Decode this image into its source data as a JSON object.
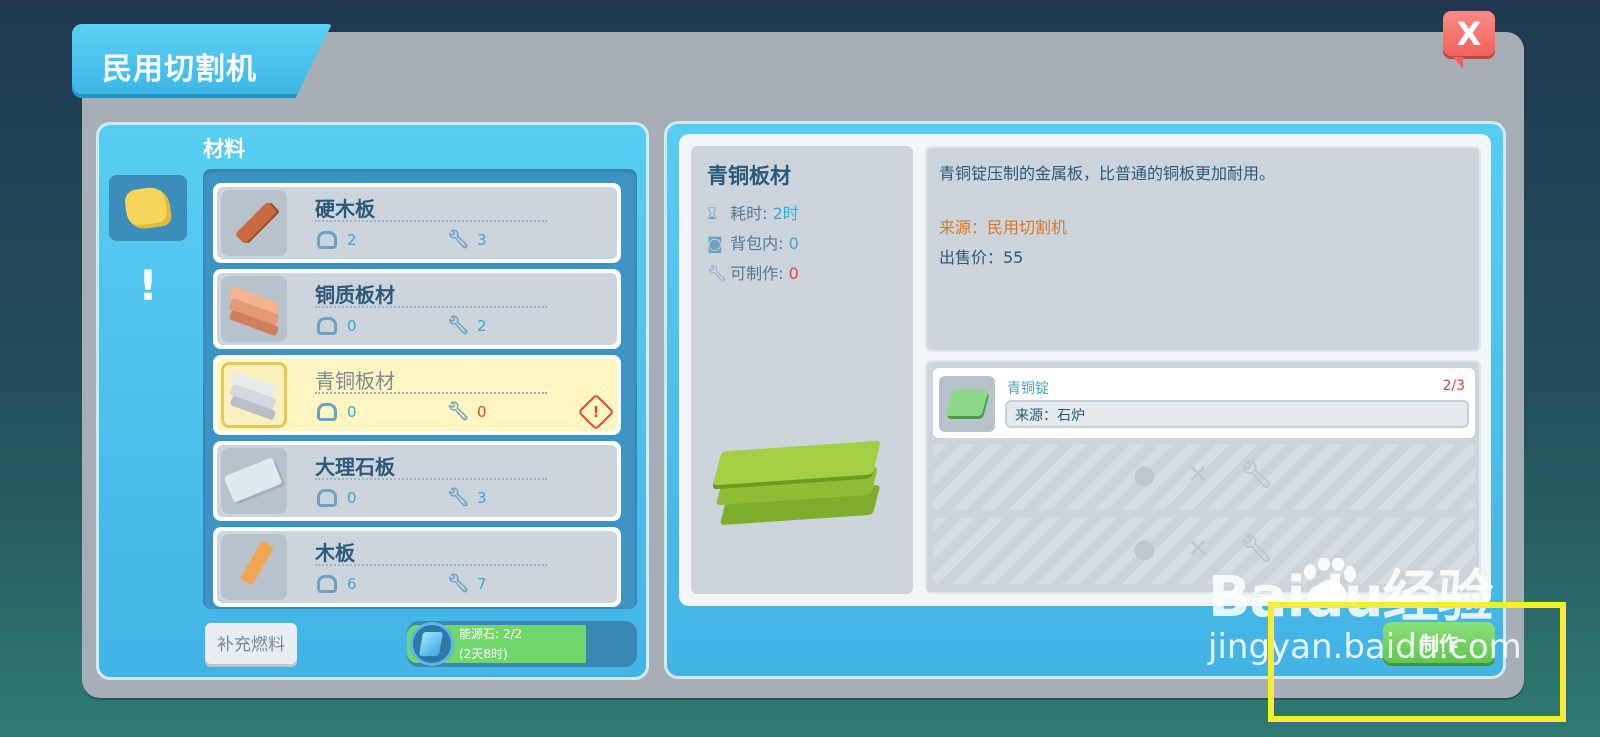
{
  "window": {
    "title": "民用切割机",
    "close_label": "X"
  },
  "left_panel": {
    "section_label": "材料",
    "category_tabs": [
      {
        "icon": "material-icon",
        "selected": true
      },
      {
        "icon": "exclamation-icon",
        "label": "!",
        "selected": false
      }
    ],
    "items": [
      {
        "name": "硬木板",
        "in_bag": "2",
        "craftable": "3",
        "thumb": "hardwood-plank",
        "selected": false
      },
      {
        "name": "铜质板材",
        "in_bag": "0",
        "craftable": "2",
        "thumb": "copper-plank",
        "selected": false
      },
      {
        "name": "青铜板材",
        "in_bag": "0",
        "craftable": "0",
        "thumb": "bronze-plank",
        "selected": true,
        "warning": "!"
      },
      {
        "name": "大理石板",
        "in_bag": "0",
        "craftable": "3",
        "thumb": "marble-slab",
        "selected": false
      },
      {
        "name": "木板",
        "in_bag": "6",
        "craftable": "7",
        "thumb": "wood-plank",
        "selected": false
      }
    ],
    "refuel_label": "补充燃料",
    "energy": {
      "label": "能源石: 2/2",
      "time": "(2天8时)",
      "fill_fraction": 0.78
    }
  },
  "detail": {
    "name": "青铜板材",
    "time_label": "耗时:",
    "time_value": "2时",
    "bag_label": "背包内:",
    "bag_value": "0",
    "craftable_label": "可制作:",
    "craftable_value": "0",
    "description": "青铜锭压制的金属板，比普通的铜板更加耐用。",
    "source": "来源：民用切割机",
    "price": "出售价：55"
  },
  "requirements": [
    {
      "name": "青铜锭",
      "count": "2/3",
      "source": "来源：石炉"
    }
  ],
  "make_label": "制作",
  "watermark": {
    "logo": "Baidu经验",
    "url": "jingyan.baidu.com"
  },
  "colors": {
    "accent": "#43b3e5",
    "make": "#5ec24f",
    "warning": "#e0473e",
    "highlight": "#f5ef2d"
  }
}
